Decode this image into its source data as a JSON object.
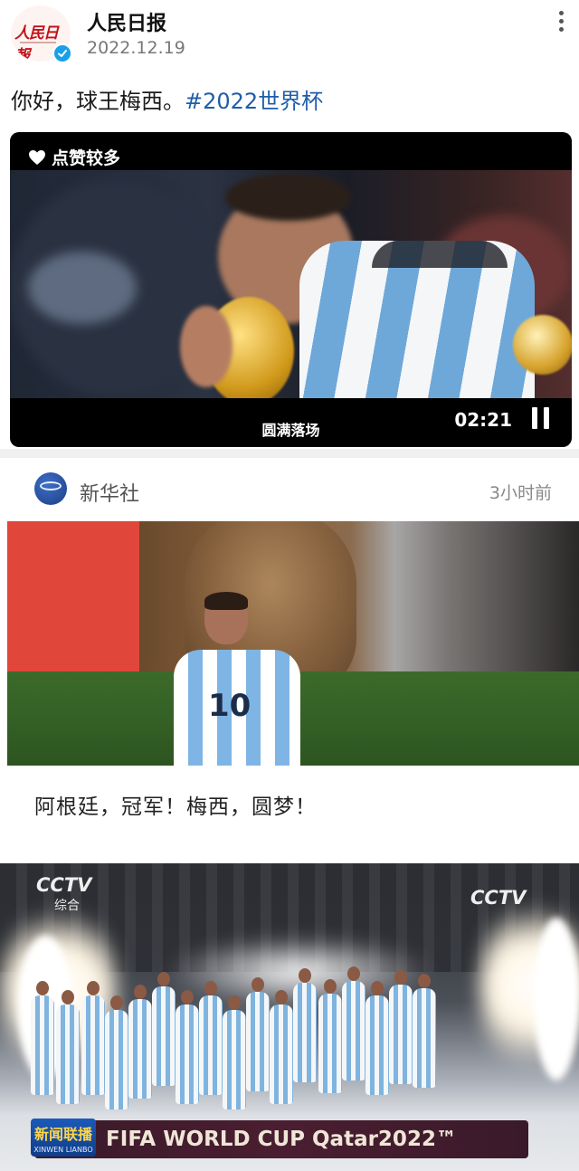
{
  "post1": {
    "account_name": "人民日报",
    "avatar_logo_text": "人民日報",
    "date": "2022.12.19",
    "text_main": "你好，球王梅西。",
    "hashtag": "#2022世界杯",
    "video": {
      "badge_label": "点赞较多",
      "caption": "圆满落场",
      "timestamp": "02:21"
    }
  },
  "post2": {
    "source_name": "新华社",
    "time_ago": "3小时前",
    "jersey_number": "10",
    "text": "阿根廷，冠军！梅西，圆梦！"
  },
  "post3": {
    "channel_logo_left": "CCTV",
    "channel_sub_left": "综合",
    "channel_logo_right": "CCTV",
    "badge_title": "新闻联播",
    "badge_sub": "XINWEN LIANBO",
    "banner_text": "FIFA WORLD CUP Qatar2022™"
  },
  "colors": {
    "hashtag": "#1f5da8",
    "verified": "#1aa0e8",
    "argentina_blue": "#7fb5e5"
  }
}
